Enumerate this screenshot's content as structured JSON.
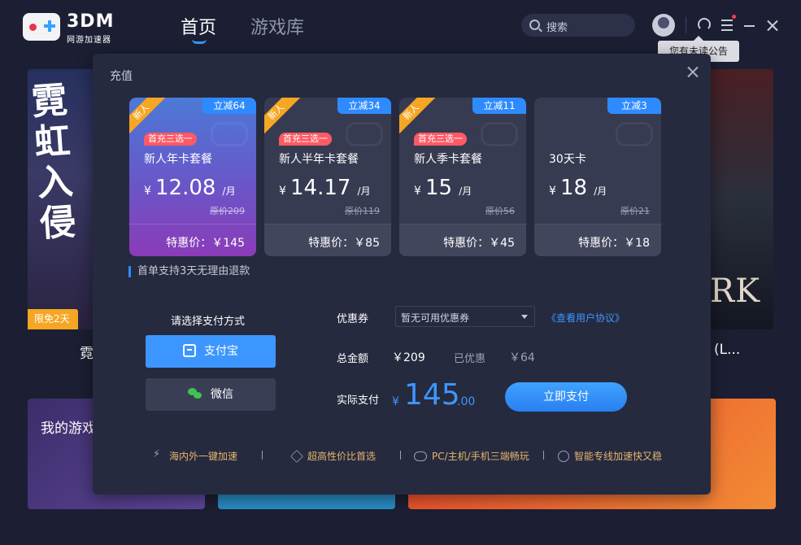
{
  "app": {
    "logo_title": "3DM",
    "logo_sub": "网游加速器"
  },
  "nav": {
    "home": "首页",
    "library": "游戏库"
  },
  "search": {
    "placeholder": "搜索"
  },
  "tooltip": "您有未读公告",
  "background": {
    "left_art": "霓虹入侵",
    "free_badge": "限免2天",
    "left_text": "霓",
    "right_art": "RK",
    "right_text": "(L...",
    "my_games": "我的游戏"
  },
  "modal": {
    "title": "充值",
    "plans": [
      {
        "discount": "立减64",
        "new": "新人",
        "pill": "首充三选一",
        "name": "新人年卡套餐",
        "currency": "¥",
        "price": "12.08",
        "unit": "/月",
        "original": "原价209",
        "special": "特惠价：￥145",
        "selected": true
      },
      {
        "discount": "立减34",
        "new": "新人",
        "pill": "首充三选一",
        "name": "新人半年卡套餐",
        "currency": "¥",
        "price": "14.17",
        "unit": "/月",
        "original": "原价119",
        "special": "特惠价：￥85",
        "selected": false
      },
      {
        "discount": "立减11",
        "new": "新人",
        "pill": "首充三选一",
        "name": "新人季卡套餐",
        "currency": "¥",
        "price": "15",
        "unit": "/月",
        "original": "原价56",
        "special": "特惠价：￥45",
        "selected": false
      },
      {
        "discount": "立减3",
        "new": "",
        "pill": "",
        "name": "30天卡",
        "currency": "¥",
        "price": "18",
        "unit": "/月",
        "original": "原价21",
        "special": "特惠价：￥18",
        "selected": false
      }
    ],
    "refund_note": "首单支持3天无理由退款",
    "payment": {
      "title": "请选择支付方式",
      "alipay": "支付宝",
      "wechat": "微信"
    },
    "coupon": {
      "label": "优惠券",
      "value": "暂无可用优惠券",
      "agreement": "《查看用户协议》"
    },
    "total": {
      "label": "总金额",
      "amount": "￥209",
      "saved_label": "已优惠",
      "saved_amount": "￥64"
    },
    "actual": {
      "label": "实际支付",
      "currency": "¥",
      "integer": "145",
      "decimal": ".00",
      "pay_button": "立即支付"
    },
    "features": [
      "海内外一键加速",
      "超高性价比首选",
      "PC/主机/手机三端畅玩",
      "智能专线加速快又稳"
    ]
  },
  "colors": {
    "accent": "#3d96ff",
    "badge_orange": "#f5a623",
    "pill_red": "#ff5a64",
    "feature_text": "#e6b46c"
  }
}
